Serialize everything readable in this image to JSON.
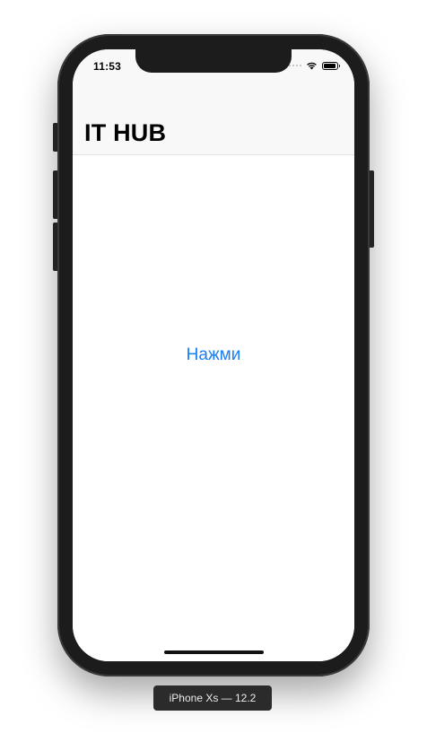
{
  "status_bar": {
    "time": "11:53",
    "wifi_icon": "wifi-icon",
    "battery_icon": "battery-icon"
  },
  "navbar": {
    "title": "IT HUB"
  },
  "main": {
    "button_label": "Нажми",
    "button_color": "#1a7ef2"
  },
  "simulator": {
    "device_label": "iPhone Xs — 12.2"
  }
}
